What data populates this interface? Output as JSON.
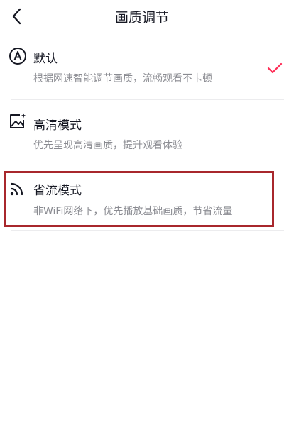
{
  "header": {
    "title": "画质调节"
  },
  "options": [
    {
      "icon": "auto-a-icon",
      "title": "默认",
      "desc": "根据网速智能调节画质，流畅观看不卡顿",
      "selected": true
    },
    {
      "icon": "hd-image-icon",
      "title": "高清模式",
      "desc": "优先呈现高清画质，提升观看体验",
      "selected": false
    },
    {
      "icon": "signal-waves-icon",
      "title": "省流模式",
      "desc": "非WiFi网络下，优先播放基础画质，节省流量",
      "selected": false
    }
  ],
  "colors": {
    "accent_check": "#fe2c55",
    "highlight_border": "#a8272c",
    "title_text": "#161823",
    "desc_text": "#8a8b91"
  }
}
